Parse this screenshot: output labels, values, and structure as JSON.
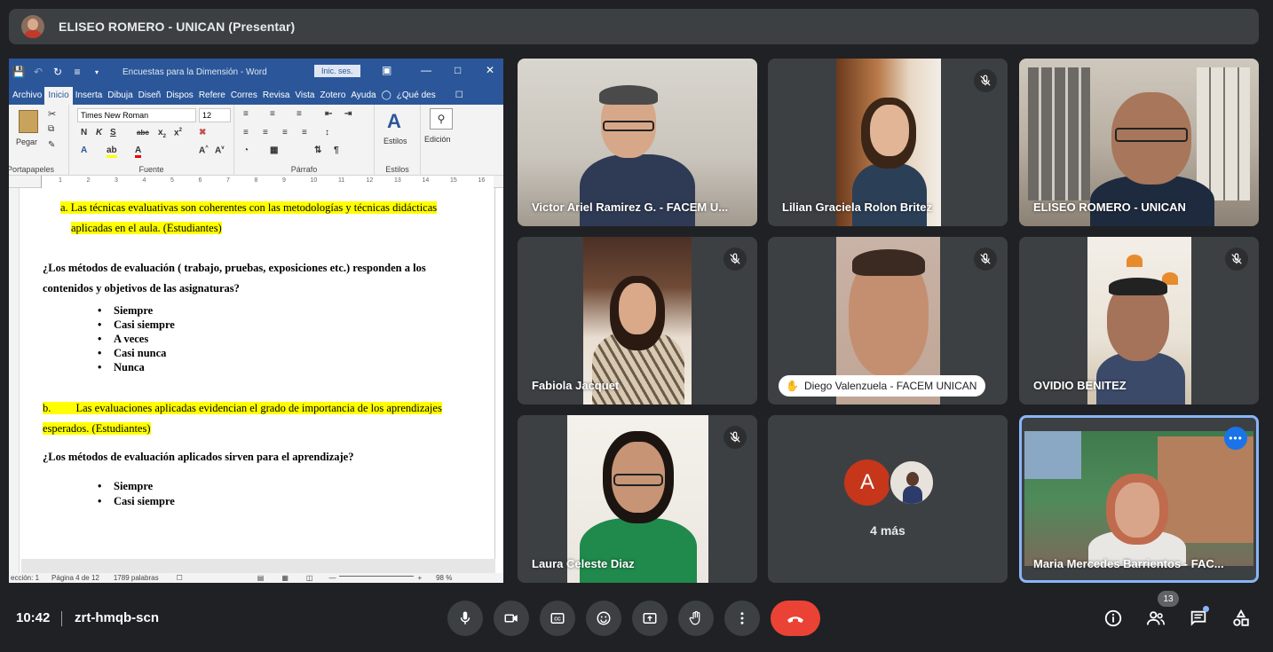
{
  "presenter": {
    "title": "ELISEO ROMERO - UNICAN (Presentar)"
  },
  "word": {
    "doc_title": "Encuestas para la Dimensión  -  Word",
    "signin": "Inic. ses.",
    "tabs": [
      "Archivo",
      "Inicio",
      "Inserta",
      "Dibuja",
      "Diseñ",
      "Dispos",
      "Refere",
      "Corres",
      "Revisa",
      "Vista",
      "Zotero",
      "Ayuda",
      "¿Qué des"
    ],
    "font_name": "Times New Roman",
    "font_size": "12",
    "groups": {
      "clipboard": "Portapapeles",
      "font": "Fuente",
      "paragraph": "Párrafo",
      "styles": "Estilos"
    },
    "paste": "Pegar",
    "styles_btn": "Estilos",
    "edit_btn": "Edición",
    "ruler_marks": [
      "1",
      "2",
      "3",
      "4",
      "5",
      "6",
      "7",
      "8",
      "9",
      "10",
      "11",
      "12",
      "13",
      "14",
      "15",
      "16"
    ],
    "content": {
      "item_a_1": "a. Las técnicas evaluativas son coherentes con las metodologías y técnicas didácticas",
      "item_a_2": "aplicadas en el aula. (Estudiantes)",
      "q1_line1": "¿Los métodos de evaluación ( trabajo, pruebas, exposiciones etc.) responden a los",
      "q1_line2": "contenidos y objetivos de las asignaturas?",
      "options1": [
        "Siempre",
        "Casi siempre",
        "A veces",
        "Casi nunca",
        "Nunca"
      ],
      "item_b_1": "b.         Las evaluaciones aplicadas evidencian el grado de importancia de los aprendizajes",
      "item_b_2": "esperados. (Estudiantes)",
      "q2": "¿Los métodos de evaluación aplicados sirven para el aprendizaje?",
      "options2": [
        "Siempre",
        "Casi siempre"
      ]
    },
    "status": {
      "section": "ección: 1",
      "page": "Página 4 de 12",
      "words": "1789 palabras",
      "zoom": "98 %"
    }
  },
  "participants": [
    {
      "name": "Victor Ariel Ramirez G. - FACEM U...",
      "muted": false
    },
    {
      "name": "Lilian Graciela Rolon Britez",
      "muted": true
    },
    {
      "name": "ELISEO ROMERO - UNICAN",
      "muted": false
    },
    {
      "name": "Fabiola Jacquet",
      "muted": true
    },
    {
      "name": "Diego Valenzuela - FACEM UNICAN",
      "muted": true,
      "hand_raised": true
    },
    {
      "name": "OVIDIO BENITEZ",
      "muted": true
    },
    {
      "name": "Laura Celeste Diaz",
      "muted": true
    },
    {
      "name": "Maria Mercedes Barrientos - FAC...",
      "muted": false
    }
  ],
  "more": {
    "initial": "A",
    "label": "4 más"
  },
  "meeting": {
    "time": "10:42",
    "code": "zrt-hmqb-scn",
    "participant_count": "13"
  },
  "colors": {
    "end_call": "#ea4335",
    "bg": "#202124",
    "tile": "#3c4043",
    "word_blue": "#2b579a",
    "highlight": "#ffff00",
    "active_border": "#8ab4f8"
  }
}
